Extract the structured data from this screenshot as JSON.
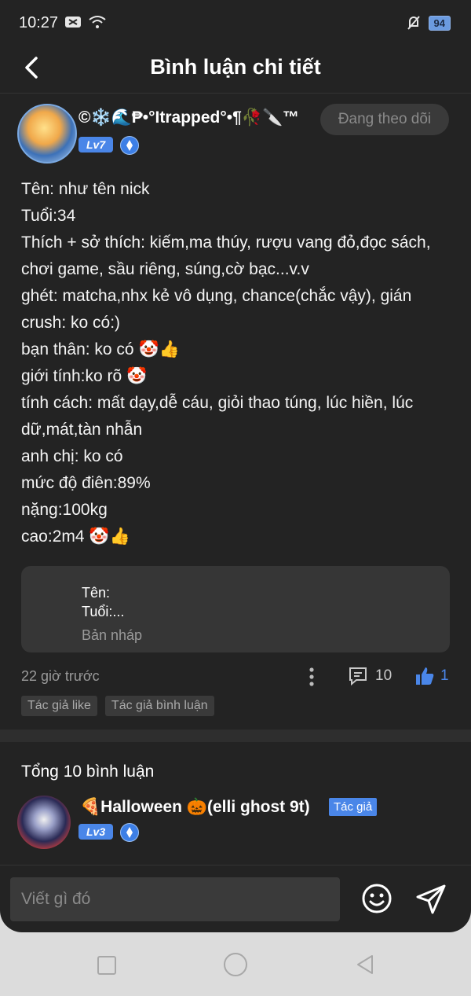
{
  "status_bar": {
    "time": "10:27",
    "battery": "94"
  },
  "header": {
    "title": "Bình luận chi tiết"
  },
  "post": {
    "author_name": "©❄️🌊₱•°Itrapped°•¶🥀🔪™",
    "level": "Lv7",
    "follow_label": "Đang theo dõi",
    "lines": [
      "Tên: như tên nick",
      "Tuổi:34",
      "Thích + sở thích: kiếm,ma thúy, rượu vang đỏ,đọc sách, chơi game, sầu riêng, súng,cờ bạc...v.v",
      "ghét: matcha,nhx kẻ vô dụng, chance(chắc vậy), gián",
      "crush: ko có:)",
      "bạn thân: ko có 🤡👍",
      "giới tính:ko rõ 🤡",
      "tính cách: mất dạy,dễ cáu, giỏi thao túng, lúc hiền, lúc dữ,mát,tàn nhẫn",
      "anh chị: ko có",
      "mức độ điên:89%",
      "nặng:100kg",
      "cao:2m4 🤡👍"
    ],
    "draft": {
      "line1": "Tên:",
      "line2": "Tuổi:...",
      "label": "Bản nháp"
    },
    "time_ago": "22 giờ trước",
    "comment_count": "10",
    "like_count": "1",
    "tags": [
      "Tác giả like",
      "Tác giả bình luận"
    ]
  },
  "comments": {
    "total_label": "Tổng 10 bình luận",
    "first": {
      "name": "🍕Halloween 🎃(elli ghost 9t)",
      "tag": "Tác giả",
      "level": "Lv3"
    }
  },
  "composer": {
    "placeholder": "Viết gì đó"
  },
  "colors": {
    "accent": "#4a86e8",
    "background": "#232323"
  }
}
